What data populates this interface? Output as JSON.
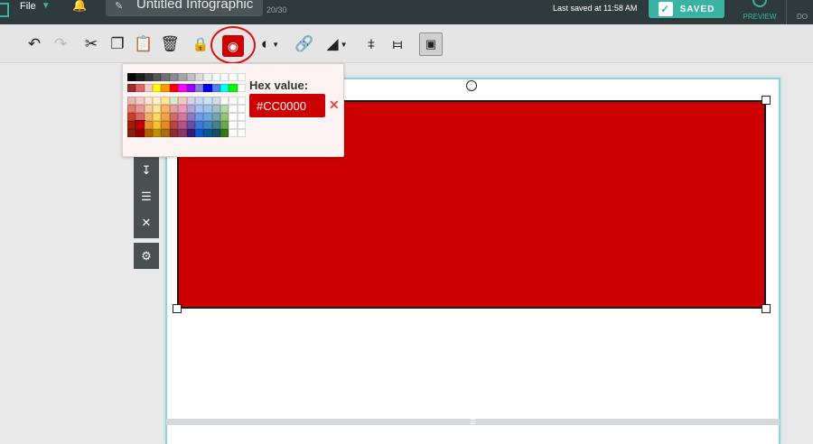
{
  "header": {
    "file_menu": "File",
    "title": "Untitled Infographic",
    "title_count": "20/30",
    "last_saved": "Last saved at 11:58 AM",
    "saved_button": "SAVED",
    "preview_label": "PREVIEW",
    "download_label": "DO"
  },
  "toolbar": {
    "icons": [
      "undo-icon",
      "redo-icon",
      "cut-icon",
      "copy-icon",
      "paste-icon",
      "delete-icon",
      "lock-icon",
      "fill-color-icon",
      "opacity-icon",
      "link-icon",
      "border-icon",
      "flip-horizontal-icon",
      "flip-vertical-icon",
      "align-icon"
    ],
    "active_tool": "fill-color"
  },
  "color_picker": {
    "hex_label": "Hex value:",
    "hex_value": "#CC0000",
    "selected_color": "#CC0000",
    "palette": [
      [
        "#000000",
        "#1f1f1f",
        "#3a3a3a",
        "#555555",
        "#707070",
        "#8c8c8c",
        "#a6a6a6",
        "#c2c2c2",
        "#dcdcdc",
        "#f2f2f2",
        "#ffffff",
        "#ffffff",
        "#ffffff",
        "#ffffff"
      ],
      [
        "#9c2b2b",
        "#e06666",
        "#f4cccc",
        "#ffff00",
        "#ff9900",
        "#ff0000",
        "#ff00ff",
        "#9900ff",
        "#7f7fd9",
        "#0000ff",
        "#4a86e8",
        "#00ffff",
        "#00ff00",
        "#ffffff"
      ],
      [
        "#e6b8af",
        "#f4cccc",
        "#fce5cd",
        "#fff2cc",
        "#ffe599",
        "#d9ead3",
        "#f4c7c3",
        "#d9d2e9",
        "#c9daf8",
        "#cfe2f3",
        "#d0e0e3",
        "#ffffff",
        "#ffffff",
        "#ffffff"
      ],
      [
        "#dd7e6b",
        "#ea9999",
        "#f9cb9c",
        "#ffe599",
        "#f6b26b",
        "#e6a0a0",
        "#ea9bbb",
        "#b4a7d6",
        "#a4c2f4",
        "#9fc5e8",
        "#a2c4c9",
        "#b6d7a8",
        "#ffffff",
        "#ffffff"
      ],
      [
        "#cc4125",
        "#e06666",
        "#f6b26b",
        "#ffd966",
        "#f1a545",
        "#d06b6b",
        "#d5779f",
        "#8e7cc3",
        "#6d9eeb",
        "#6fa8dc",
        "#76a5af",
        "#93c47d",
        "#ffffff",
        "#ffffff"
      ],
      [
        "#a61c00",
        "#cc0000",
        "#e69138",
        "#f1c232",
        "#e08a20",
        "#b84545",
        "#b55284",
        "#674ea7",
        "#3c78d8",
        "#3d85c6",
        "#45818e",
        "#6aa84f",
        "#ffffff",
        "#ffffff"
      ],
      [
        "#85200c",
        "#990000",
        "#b45f06",
        "#bf9000",
        "#a86d10",
        "#8e2c2c",
        "#8a3566",
        "#351c75",
        "#1155cc",
        "#0b5394",
        "#134f5c",
        "#38761d",
        "#ffffff",
        "#ffffff"
      ]
    ]
  },
  "side_toolbar": [
    "send-backward-icon",
    "layers-icon",
    "remove-icon",
    "settings-icon"
  ],
  "canvas": {
    "shape_fill": "#CC0000",
    "background": "#ffffff"
  }
}
